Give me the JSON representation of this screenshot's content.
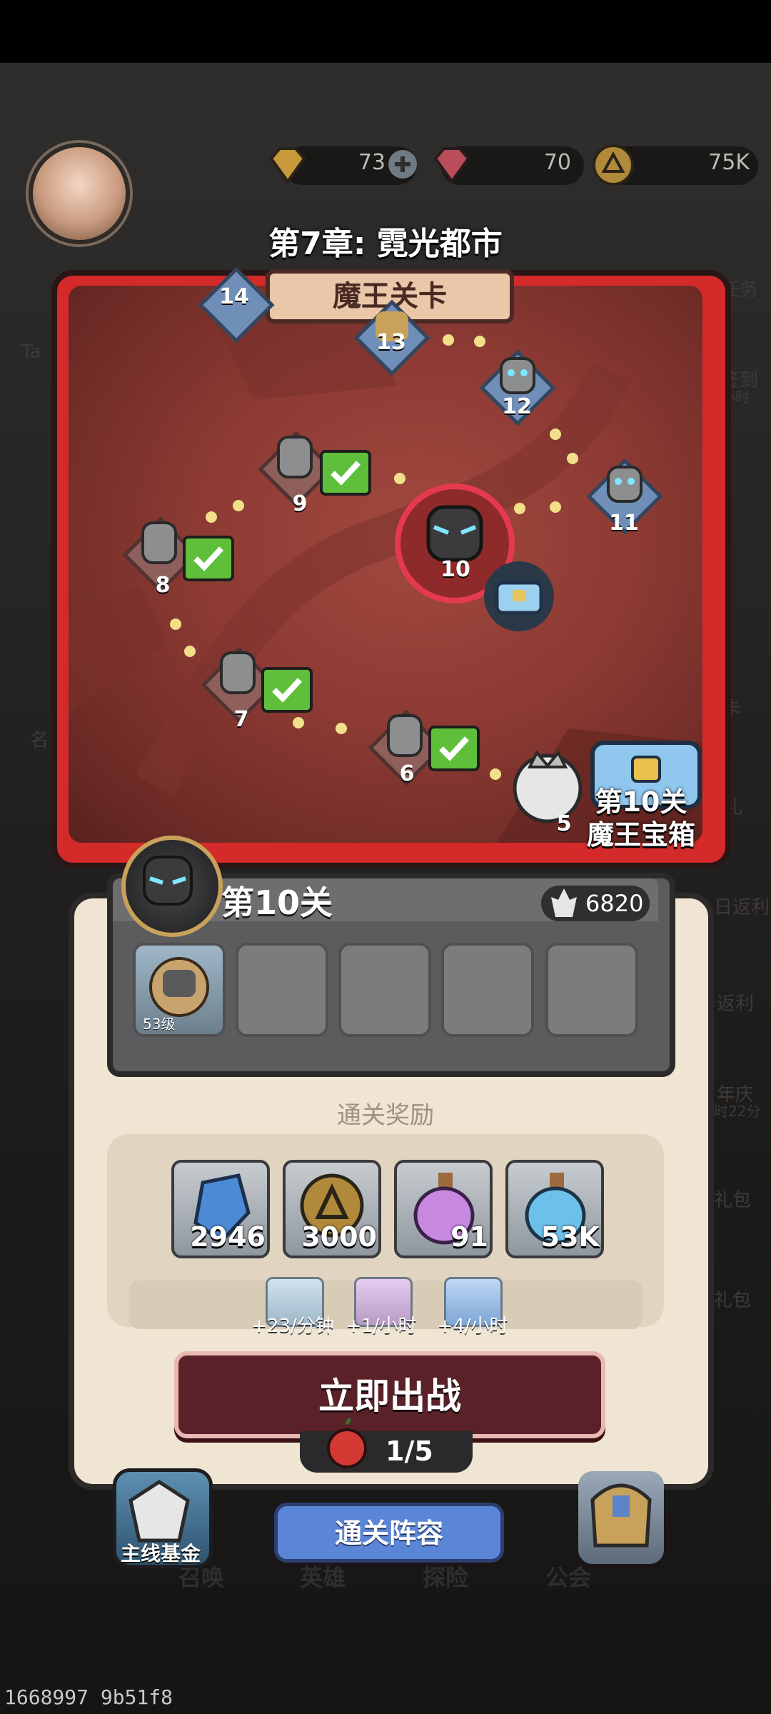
{
  "header": {
    "currencies": [
      {
        "icon": "gold-gem-icon",
        "value": "73"
      },
      {
        "icon": "red-gem-icon",
        "value": "70"
      },
      {
        "icon": "gold-coin-icon",
        "value": "75K"
      }
    ]
  },
  "side_menu": {
    "right": [
      "任务",
      "签到",
      "小时",
      "卡",
      "礼",
      "日返利",
      "返利",
      "年庆",
      "时22分",
      "礼包",
      "礼包"
    ],
    "left": [
      "Ta",
      "名"
    ]
  },
  "chapter": {
    "title": "第7章: 霓光都市",
    "banner": "魔王关卡",
    "nodes": [
      "14",
      "13",
      "12",
      "11",
      "10",
      "9",
      "8",
      "7",
      "6",
      "5"
    ],
    "chest_label_1": "第10关",
    "chest_label_2": "魔王宝箱"
  },
  "stage": {
    "name": "第10关",
    "power": "6820",
    "hero_level": "53级",
    "rewards_title": "通关奖励",
    "rewards": [
      {
        "icon": "crystal-icon",
        "qty": "2946"
      },
      {
        "icon": "coin-icon",
        "qty": "3000"
      },
      {
        "icon": "purple-potion-icon",
        "qty": "91"
      },
      {
        "icon": "blue-potion-icon",
        "qty": "53K"
      }
    ],
    "rates": [
      "+23/分钟",
      "+1/小时",
      "+4/小时"
    ],
    "fight_label": "立即出战",
    "stamina": "1/5"
  },
  "bottom": {
    "fund_label": "主线基金",
    "lineup_label": "通关阵容",
    "nav": [
      "召唤",
      "英雄",
      "探险",
      "公会"
    ]
  },
  "build_id": "1668997 9b51f8"
}
